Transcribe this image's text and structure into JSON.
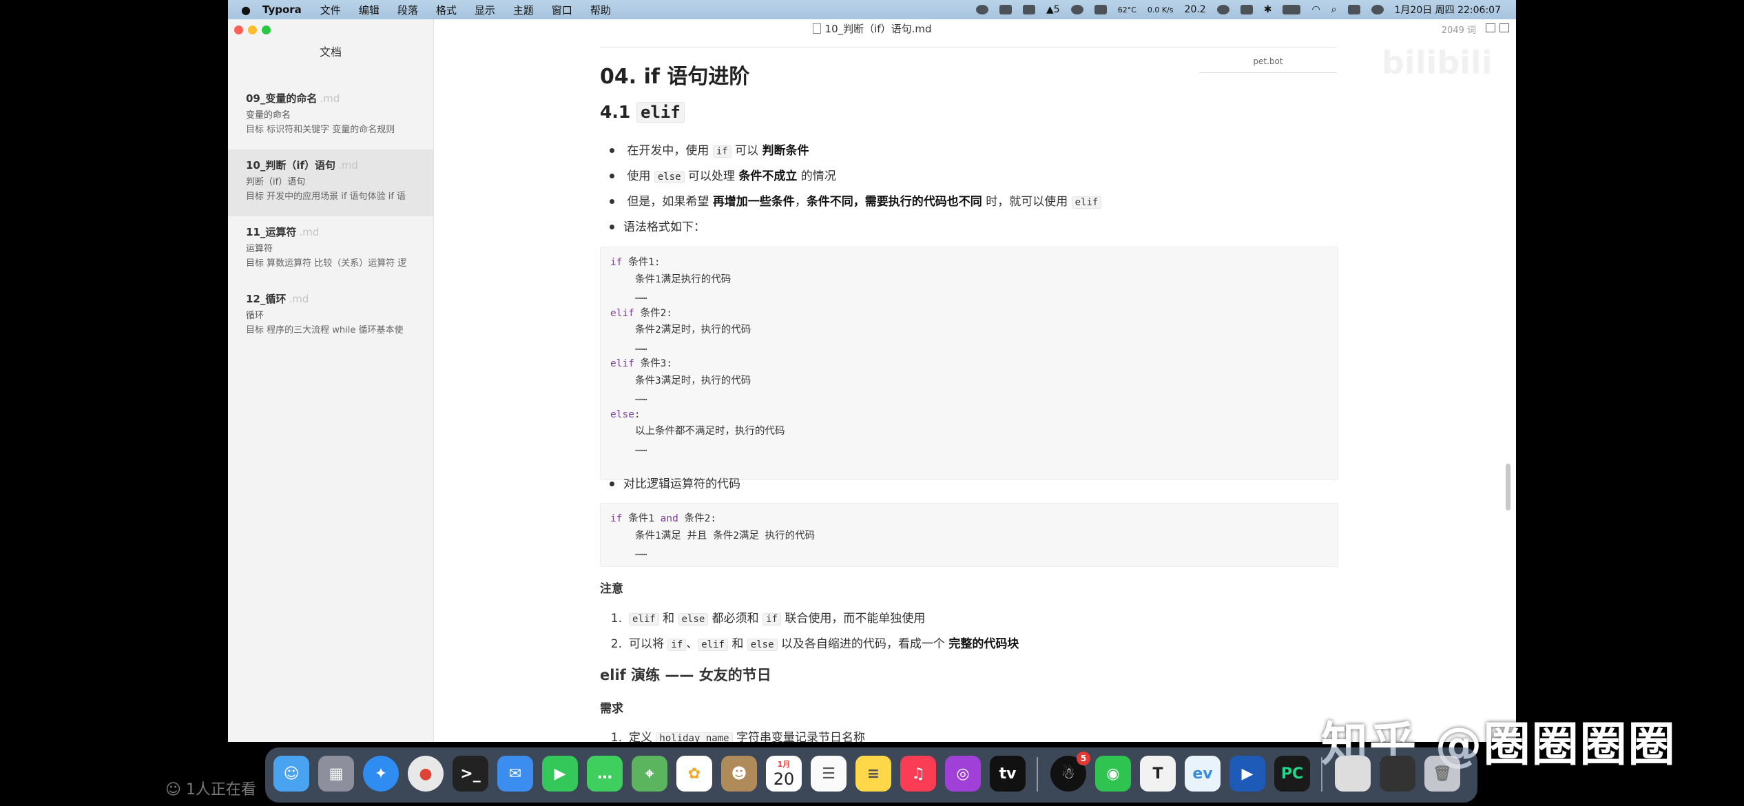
{
  "menubar": {
    "apple": "",
    "app": "Typora",
    "items": [
      "文件",
      "编辑",
      "段落",
      "格式",
      "显示",
      "主题",
      "窗口",
      "帮助"
    ],
    "temp": "62°C",
    "net": "0.0 K/s",
    "battery_num": "20.2",
    "count5": "5",
    "datetime": "1月20日 周四  22:06:07"
  },
  "window": {
    "doc_title": "10_判断（if）语句.md",
    "wordcount": "2049 词",
    "top_box": "pet.bot"
  },
  "sidebar": {
    "title": "文档",
    "items": [
      {
        "name": "09_变量的命名",
        "ext": ".md",
        "line1": "变量的命名",
        "line2": "目标 标识符和关键字 变量的命名规则"
      },
      {
        "name": "10_判断（if）语句",
        "ext": ".md",
        "line1": "判断（if）语句",
        "line2": "目标 开发中的应用场景 if 语句体验 if 语"
      },
      {
        "name": "11_运算符",
        "ext": ".md",
        "line1": "运算符",
        "line2": "目标 算数运算符 比较（关系）运算符 逻"
      },
      {
        "name": "12_循环",
        "ext": ".md",
        "line1": "循环",
        "line2": "目标 程序的三大流程 while 循环基本使"
      }
    ]
  },
  "content": {
    "h2": "04. if 语句进阶",
    "h3_prefix": "4.1 ",
    "h3_code": "elif",
    "bullets": {
      "b1_pre": "在开发中，使用 ",
      "b1_code": "if",
      "b1_mid": " 可以 ",
      "b1_bold": "判断条件",
      "b2_pre": "使用 ",
      "b2_code": "else",
      "b2_mid": " 可以处理 ",
      "b2_bold": "条件不成立",
      "b2_post": " 的情况",
      "b3_pre": "但是，如果希望 ",
      "b3_bold1": "再增加一些条件",
      "b3_sep1": "，",
      "b3_bold2": "条件不同，需要执行的代码也不同",
      "b3_post": " 时，就可以使用 ",
      "b3_code": "elif",
      "b4": "语法格式如下："
    },
    "code1": {
      "l1_kw": "if",
      "l1_txt": " 条件1:",
      "l2": "条件1满足执行的代码",
      "l3": "……",
      "l4_kw": "elif",
      "l4_txt": " 条件2:",
      "l5": "条件2满足时，执行的代码",
      "l6": "……",
      "l7_kw": "elif",
      "l7_txt": " 条件3:",
      "l8": "条件3满足时，执行的代码",
      "l9": "……",
      "l10_kw": "else",
      "l10_txt": ":",
      "l11": "以上条件都不满足时，执行的代码",
      "l12": "……"
    },
    "bullet5": "对比逻辑运算符的代码",
    "code2": {
      "l1_kw": "if",
      "l1_a": " 条件1 ",
      "l1_kw2": "and",
      "l1_b": " 条件2:",
      "l2": "条件1满足 并且 条件2满足 执行的代码",
      "l3": "……"
    },
    "note_title": "注意",
    "notes": {
      "n1_num": "1.",
      "n1_code1": "elif",
      "n1_t1": " 和 ",
      "n1_code2": "else",
      "n1_t2": " 都必须和 ",
      "n1_code3": "if",
      "n1_t3": " 联合使用，而不能单独使用",
      "n2_num": "2.",
      "n2_t0": "可以将 ",
      "n2_code1": "if",
      "n2_t1": "、",
      "n2_code2": "elif",
      "n2_t2": " 和 ",
      "n2_code3": "else",
      "n2_t3": " 以及各自缩进的代码，看成一个 ",
      "n2_bold": "完整的代码块"
    },
    "h4": "elif 演练 —— 女友的节日",
    "req_title": "需求",
    "req1_num": "1.",
    "req1_pre": "定义 ",
    "req1_code": "holiday_name",
    "req1_post": " 字符串变量记录节日名称"
  },
  "overlay": {
    "watermark": "知乎 @圈圈圈圈",
    "bili": "bilibili",
    "viewers": "1人正在看"
  },
  "dock": {
    "calendar_month": "1月",
    "calendar_day": "20",
    "qq_badge": "5"
  },
  "colors": {
    "menubar_bg": "#b0cbe2",
    "sidebar_bg": "#f3f3f3",
    "keyword": "#7a3ea0",
    "codeblock_bg": "#f7f7f7"
  }
}
